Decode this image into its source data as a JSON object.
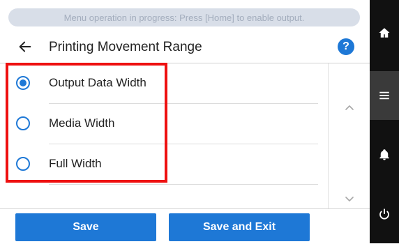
{
  "banner": {
    "text": "Menu operation in progress: Press [Home] to enable output."
  },
  "header": {
    "title": "Printing Movement Range",
    "help_label": "?"
  },
  "options": [
    {
      "label": "Output Data Width",
      "selected": true
    },
    {
      "label": "Media Width",
      "selected": false
    },
    {
      "label": "Full Width",
      "selected": false
    }
  ],
  "footer": {
    "save_label": "Save",
    "save_exit_label": "Save and Exit"
  },
  "sidebar": {
    "items": [
      "home-icon",
      "menu-icon",
      "bell-icon",
      "power-icon"
    ],
    "active": "menu-icon"
  },
  "colors": {
    "accent": "#1e78d6",
    "highlight": "#ee1111",
    "sidebar_bg": "#111111"
  }
}
